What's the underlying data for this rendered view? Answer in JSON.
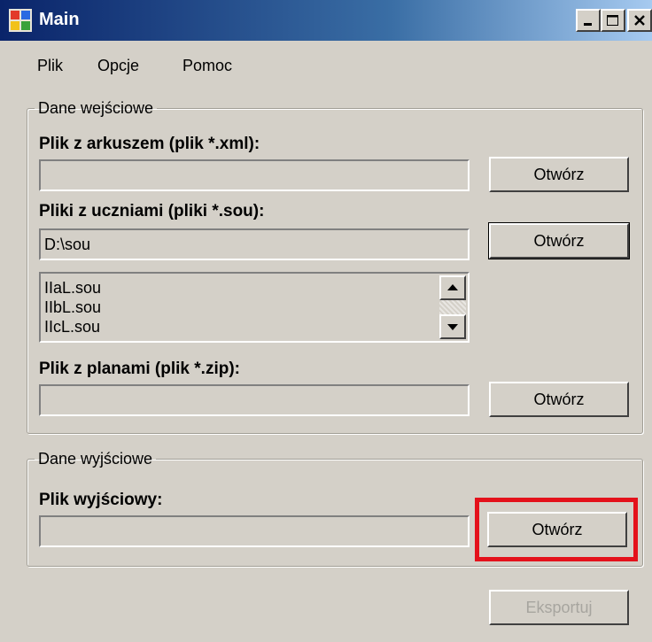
{
  "window": {
    "title": "Main",
    "controls": [
      "minimize-icon",
      "maximize-icon",
      "close-icon"
    ]
  },
  "menu": {
    "items": [
      "Plik",
      "Opcje",
      "Pomoc"
    ]
  },
  "input_group": {
    "legend": "Dane wejściowe",
    "sheet_label": "Plik z arkuszem (plik *.xml):",
    "sheet_value": "",
    "sheet_button": "Otwórz",
    "students_label": "Pliki z uczniami (pliki *.sou):",
    "students_value": "D:\\sou",
    "students_button": "Otwórz",
    "student_files": [
      "IIaL.sou",
      "IIbL.sou",
      "IIcL.sou"
    ],
    "plans_label": "Plik z planami (plik *.zip):",
    "plans_value": "",
    "plans_button": "Otwórz"
  },
  "output_group": {
    "legend": "Dane wyjściowe",
    "output_label": "Plik wyjściowy:",
    "output_value": "",
    "output_button": "Otwórz"
  },
  "export_button": "Eksportuj",
  "colors": {
    "highlight": "#e4111b",
    "face": "#d4d0c8",
    "title_bar": "#0a246a"
  }
}
